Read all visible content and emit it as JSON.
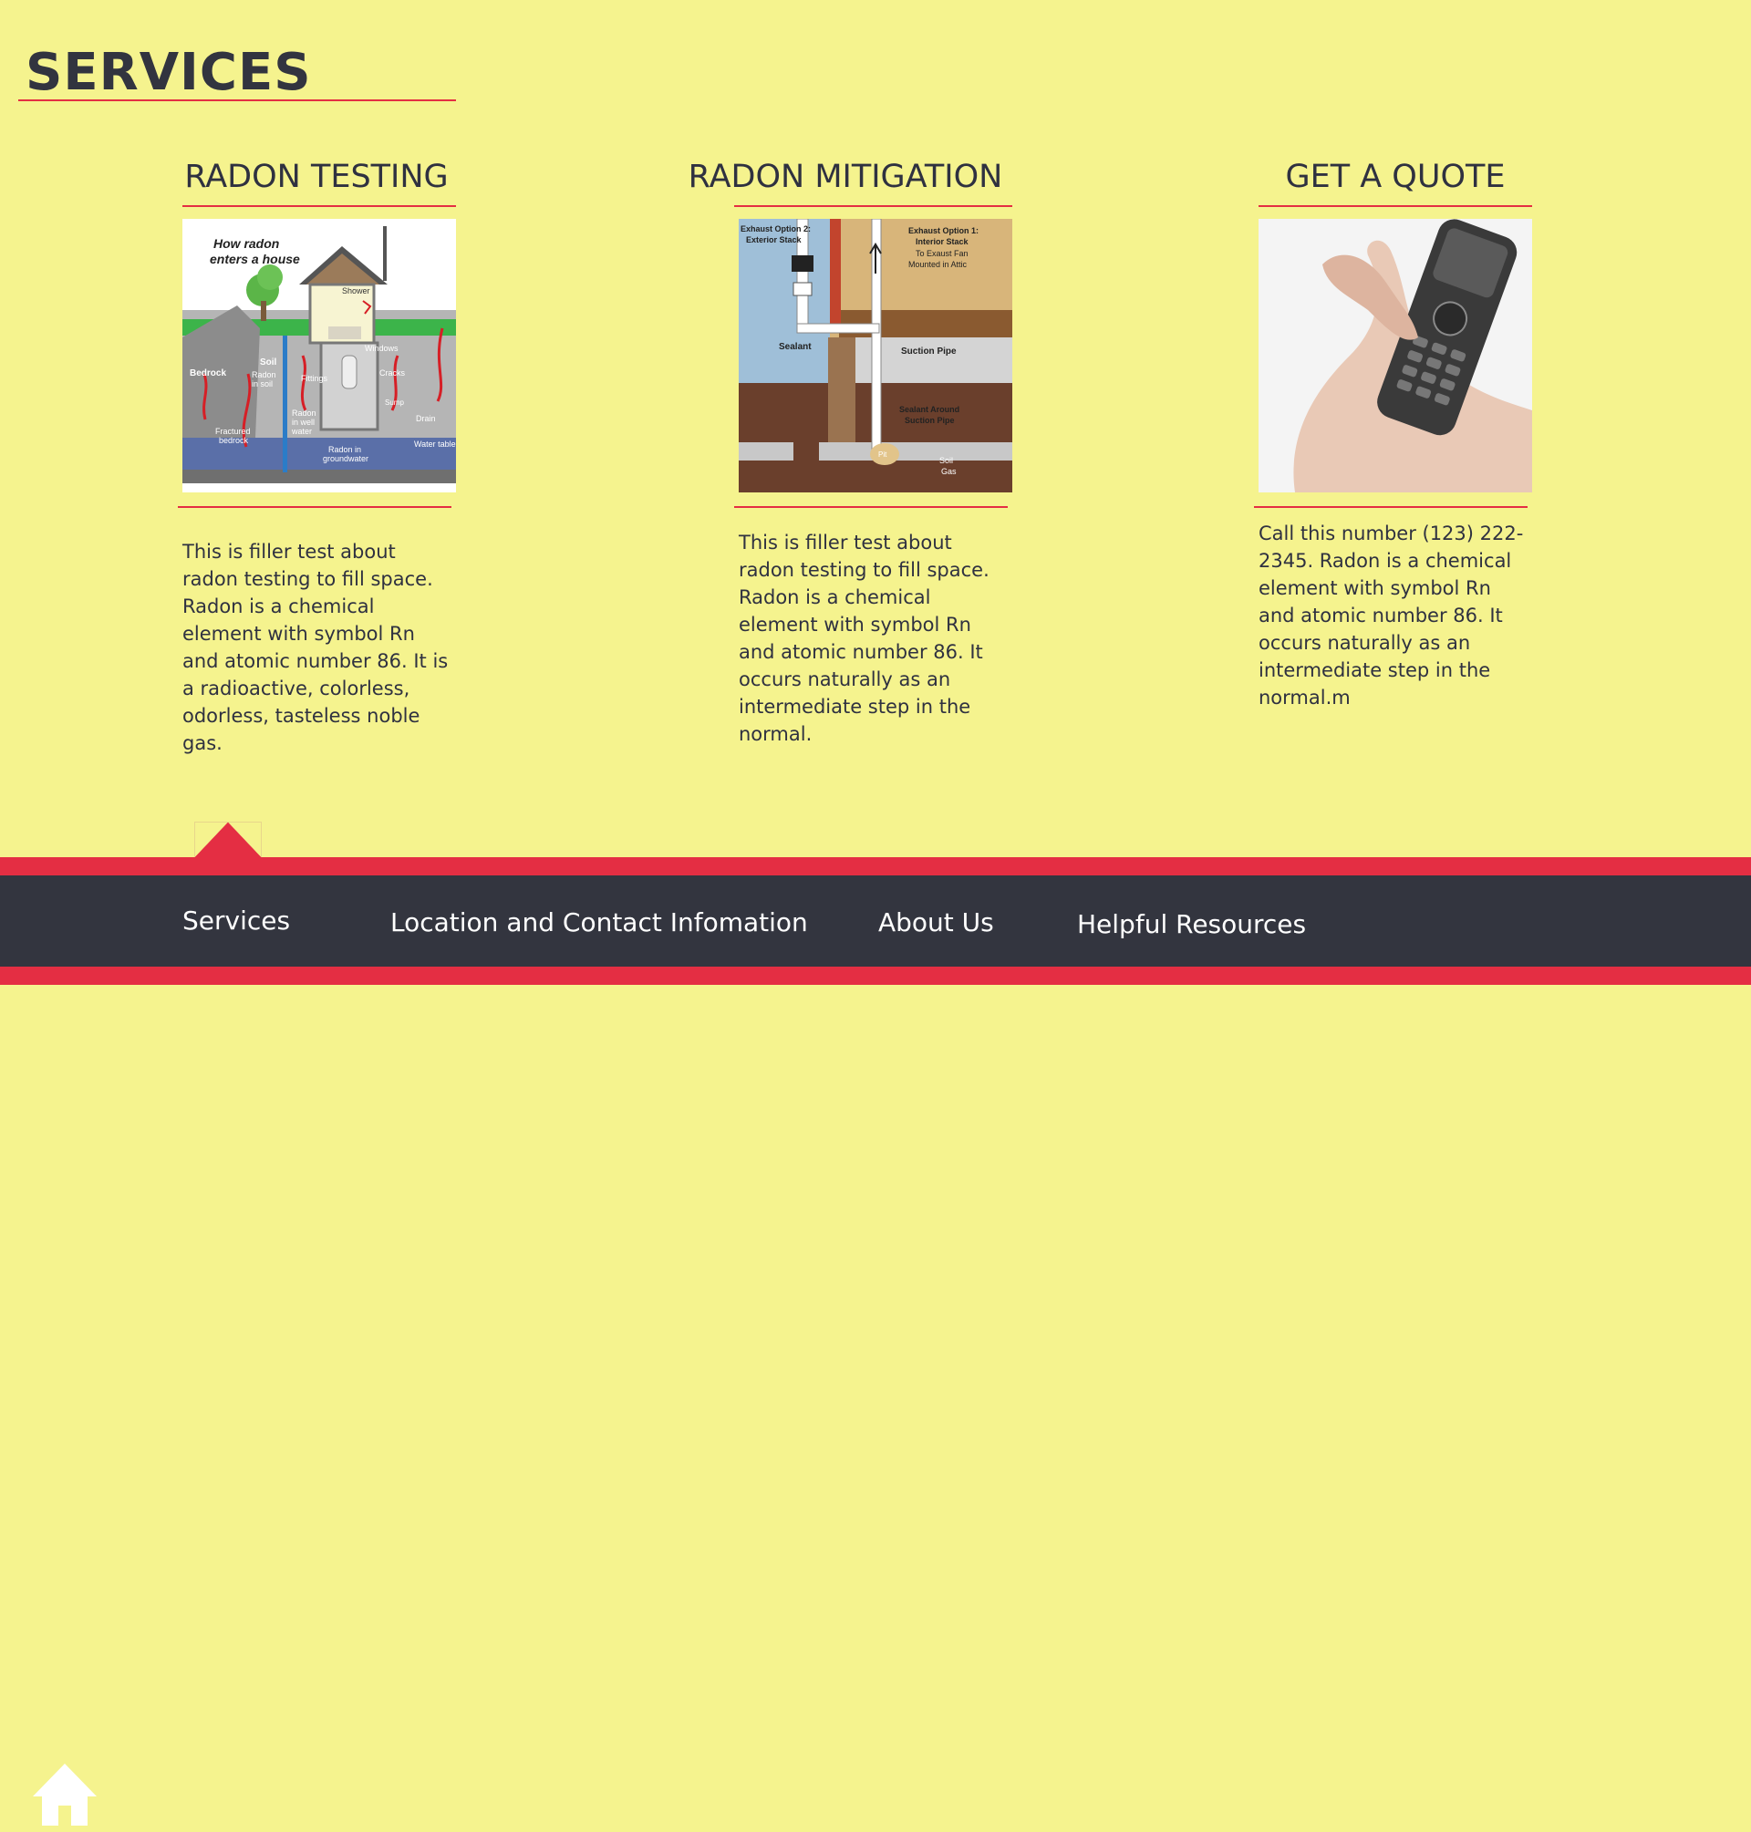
{
  "page": {
    "title": "SERVICES"
  },
  "columns": [
    {
      "heading": "RADON TESTING",
      "image_label": "radon-house-diagram",
      "diagram_text": {
        "title_line1": "How radon",
        "title_line2": "enters a house",
        "shower": "Shower",
        "windows": "Windows",
        "soil": "Soil",
        "bedrock": "Bedrock",
        "radon_in_soil_1": "Radon",
        "radon_in_soil_2": "in soil",
        "fittings": "Fittings",
        "cracks": "Cracks",
        "sump": "Sump",
        "drain": "Drain",
        "radon_well_1": "Radon",
        "radon_well_2": "in well",
        "radon_well_3": "water",
        "fractured_1": "Fractured",
        "fractured_2": "bedrock",
        "groundwater_1": "Radon in",
        "groundwater_2": "groundwater",
        "water_table": "Water table"
      },
      "text": "This is filler test about radon testing to fill space. Radon is a chemical element with symbol Rn and atomic number 86. It is a radioactive, colorless, odorless, tasteless noble gas."
    },
    {
      "heading": "RADON MITIGATION",
      "image_label": "radon-mitigation-diagram",
      "diagram_text": {
        "opt2_line1": "Exhaust Option 2:",
        "opt2_line2": "Exterior Stack",
        "opt1_line1": "Exhaust Option 1:",
        "opt1_line2": "Interior Stack",
        "opt1_line3": "To Exaust Fan",
        "opt1_line4": "Mounted in Attic",
        "sealant": "Sealant",
        "suction_pipe": "Suction Pipe",
        "sealant_around_1": "Sealant Around",
        "sealant_around_2": "Suction Pipe",
        "pit": "Pit",
        "soil_gas_1": "Soil",
        "soil_gas_2": "Gas"
      },
      "text": "This is filler test about radon testing to fill space. Radon is a chemical element with symbol Rn and atomic number 86. It occurs naturally as an intermediate step in the normal."
    },
    {
      "heading": "GET A QUOTE",
      "image_label": "hand-holding-phone-photo",
      "text": "Call this number (123) 222-2345. Radon is a chemical element with symbol Rn and atomic number 86. It occurs naturally as an intermediate step in the normal.m"
    }
  ],
  "nav": {
    "home_icon": "home-icon",
    "active_item": "Services",
    "items": [
      {
        "label": "Services"
      },
      {
        "label": "Location and Contact Infomation"
      },
      {
        "label": "About Us"
      },
      {
        "label": "Helpful Resources"
      }
    ]
  },
  "colors": {
    "background": "#f5f38e",
    "accent": "#e42e43",
    "nav_background": "#33353f",
    "text": "#2f3140"
  }
}
